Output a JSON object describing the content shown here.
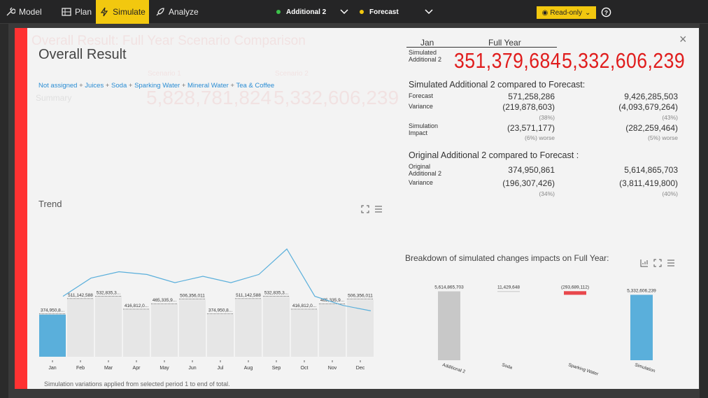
{
  "toolbar": {
    "model_label": "Model",
    "plan_label": "Plan",
    "simulate_label": "Simulate",
    "analyze_label": "Analyze",
    "scenario1": "Additional 2",
    "scenario1_color": "#3cc24a",
    "scenario2": "Forecast",
    "scenario2_color": "#f2c80f",
    "readonly_label": "Read-only",
    "accent": "#f2c80f"
  },
  "background": {
    "ghost_title": "Overall Result: Full Year Scenario Comparison",
    "ghost_card1_title": "Scenario 1",
    "ghost_card1_value": "5,828,781,824",
    "ghost_card2_title": "Scenario 2",
    "ghost_card2_value": "5,332,606,239",
    "ghost_nav": "Summary"
  },
  "modal": {
    "title": "Overall Result",
    "filters": [
      {
        "text": "Not assigned",
        "sep": " + "
      },
      {
        "text": "Juices",
        "sep": " + "
      },
      {
        "text": "Soda",
        "sep": " + "
      },
      {
        "text": "Sparking Water",
        "sep": " + "
      },
      {
        "text": "Mineral Water",
        "sep": " + "
      },
      {
        "text": "Tea & Coffee",
        "sep": ""
      }
    ],
    "trend_label": "Trend",
    "footnote": "Simulation variations applied from selected period 1 to end of total.",
    "close": "×",
    "summary": {
      "col1_header": "Jan",
      "col2_header": "Full Year",
      "row_label": "Simulated Additional 2",
      "jan_value": "351,379,684",
      "fy_value": "5,332,606,239"
    },
    "section1": {
      "title": "Simulated Additional 2 compared to Forecast:",
      "forecast_label": "Forecast",
      "forecast_jan": "571,258,286",
      "forecast_fy": "9,426,285,503",
      "variance_label": "Variance",
      "variance_jan": "(219,878,603)",
      "variance_fy": "(4,093,679,264)",
      "variance_jan_pct": "(38%)",
      "variance_fy_pct": "(43%)",
      "impact_label": "Simulation Impact",
      "impact_jan": "(23,571,177)",
      "impact_fy": "(282,259,464)",
      "impact_jan_pct": "(6%) worse",
      "impact_fy_pct": "(5%) worse"
    },
    "section2": {
      "title": "Original Additional 2 compared to Forecast :",
      "original_label": "Original Additional 2",
      "original_jan": "374,950,861",
      "original_fy": "5,614,865,703",
      "variance_label": "Variance",
      "variance_jan": "(196,307,426)",
      "variance_fy": "(3,811,419,800)",
      "variance_jan_pct": "(34%)",
      "variance_fy_pct": "(40%)"
    },
    "breakdown_title": "Breakdown of simulated changes impacts on Full Year:"
  },
  "chart_data": [
    {
      "type": "bar",
      "title": "Trend",
      "categories": [
        "Jan",
        "Feb",
        "Mar",
        "Apr",
        "May",
        "Jun",
        "Jul",
        "Aug",
        "Sep",
        "Oct",
        "Nov",
        "Dec"
      ],
      "values": [
        374950861,
        511142588,
        532835300,
        416812000,
        465335900,
        506356011,
        374950800,
        511142588,
        532835300,
        416812000,
        465335900,
        506356011
      ],
      "data_labels": [
        "374,950,8...",
        "511,142,588",
        "532,835,3...",
        "416,812,0...",
        "465,335,9...",
        "506,356,011",
        "374,950,8...",
        "511,142,588",
        "532,835,3...",
        "416,812,0...",
        "465,335,9...",
        "506,356,011"
      ],
      "highlight_index": 0,
      "bar_color": "#e6e6e6",
      "highlight_color": "#5aafdb",
      "line_series": [
        0.28,
        0.48,
        0.55,
        0.52,
        0.43,
        0.5,
        0.43,
        0.52,
        0.8,
        0.28,
        0.18,
        0.12
      ],
      "line_color": "#5aafdb"
    },
    {
      "type": "bar",
      "subtype": "waterfall",
      "title": "Breakdown of simulated changes impacts on Full Year:",
      "categories": [
        "Additional 2",
        "Soda",
        "Sparking Water",
        "Simulation"
      ],
      "values": [
        5614865703,
        11429648,
        -293689112,
        5332606239
      ],
      "data_labels": [
        "5,614,865,703",
        "11,429,648",
        "(293,689,112)",
        "5,332,606,239"
      ],
      "colors": [
        "#c8c8c8",
        "#c8c8c8",
        "#e8474c",
        "#5aafdb"
      ],
      "ylim": [
        0,
        5700000000
      ]
    }
  ]
}
